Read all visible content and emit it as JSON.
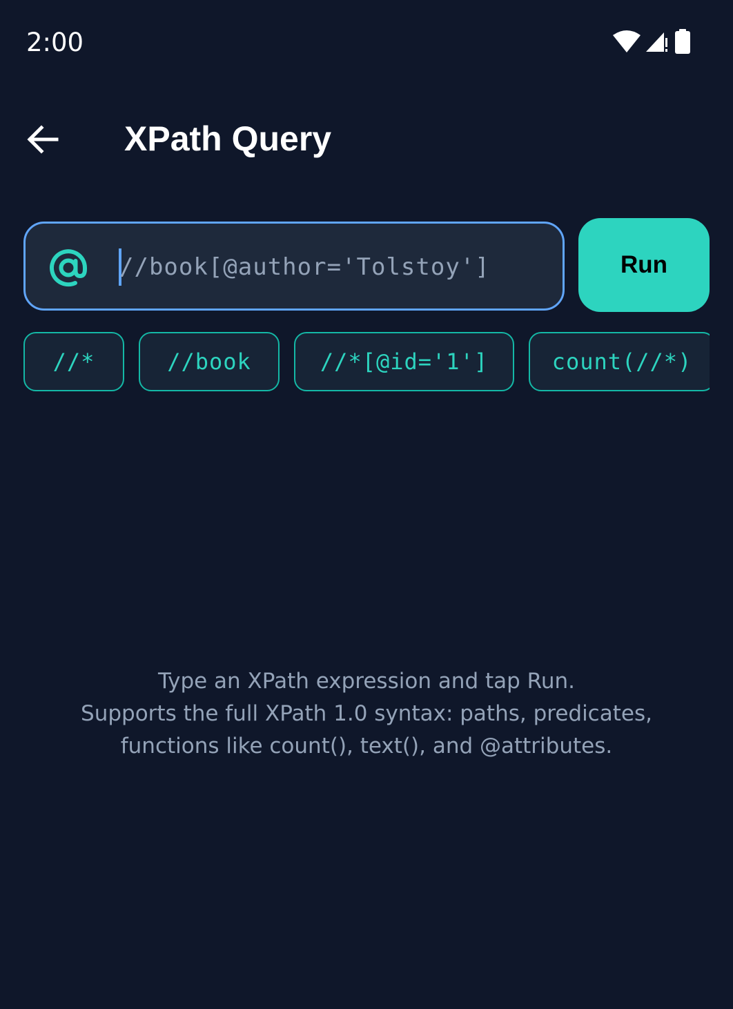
{
  "status_bar": {
    "time": "2:00",
    "icons": [
      "wifi-icon",
      "cellular-signal-icon",
      "battery-icon"
    ]
  },
  "app_bar": {
    "back_icon": "arrow-left-icon",
    "title": "XPath Query"
  },
  "query": {
    "icon": "at-sign-icon",
    "value": "",
    "placeholder": "//book[@author='Tolstoy']",
    "run_label": "Run"
  },
  "suggestions": [
    {
      "label": "//*"
    },
    {
      "label": "//book"
    },
    {
      "label": "//*[@id='1']"
    },
    {
      "label": "count(//*)"
    }
  ],
  "help": {
    "line1": "Type an XPath expression and tap Run.",
    "line2": "Supports the full XPath 1.0 syntax: paths, predicates,",
    "line3": "functions like count(), text(), and @attributes."
  },
  "colors": {
    "background": "#0f172a",
    "accent": "#2dd4bf",
    "focus_border": "#60a5fa",
    "field_background": "#1e293b",
    "muted_text": "#94a3b8"
  }
}
